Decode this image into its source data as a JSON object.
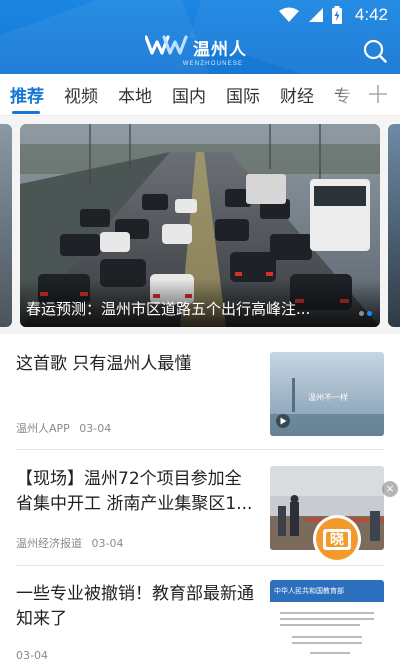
{
  "status_bar": {
    "time": "4:42",
    "icons": [
      "wifi-icon",
      "cell-signal-icon",
      "battery-charging-icon"
    ]
  },
  "header": {
    "logo_name": "温州人",
    "logo_subtitle": "WENZHOUNESE",
    "brand_color": "#1677d4",
    "search_icon": "search-icon"
  },
  "tabs": {
    "items": [
      {
        "label": "推荐",
        "active": true
      },
      {
        "label": "视频"
      },
      {
        "label": "本地"
      },
      {
        "label": "国内"
      },
      {
        "label": "国际"
      },
      {
        "label": "财经"
      },
      {
        "label": "专"
      }
    ],
    "add_icon": "plus-icon"
  },
  "carousel": {
    "caption": "春运预测：温州市区道路五个出行高峰注...",
    "active_dot_color": "#1e88ff"
  },
  "articles": [
    {
      "title": "这首歌 只有温州人最懂",
      "source": "温州人APP",
      "date": "03-04",
      "thumb_text": "温州不一样"
    },
    {
      "title": "【现场】温州72个项目参加全省集中开工 浙南产业集聚区1...",
      "source": "温州经济报道",
      "date": "03-04"
    },
    {
      "title": "一些专业被撤销！教育部最新通知来了",
      "source": "",
      "date": "03-04",
      "thumb_text": "中华人民共和国教育部"
    }
  ],
  "floating_widget": {
    "label": "晓",
    "close": "×"
  }
}
